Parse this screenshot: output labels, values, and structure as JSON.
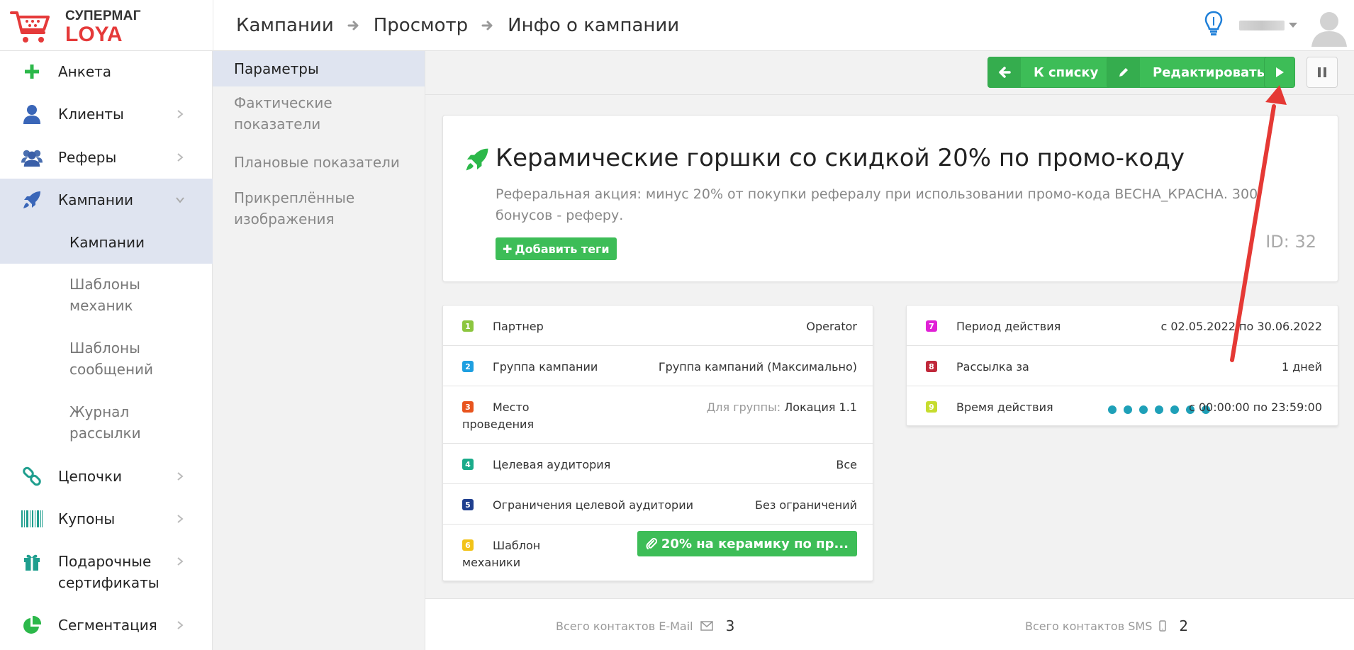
{
  "app": {
    "logo_top": "СУПЕРМАГ",
    "logo_bottom": "LOYA"
  },
  "breadcrumb": [
    "Кампании",
    "Просмотр",
    "Инфо о кампании"
  ],
  "sidebar": {
    "items": [
      {
        "label": "Анкета",
        "icon": "plus-icon"
      },
      {
        "label": "Клиенты",
        "icon": "user-icon"
      },
      {
        "label": "Реферы",
        "icon": "users-icon"
      },
      {
        "label": "Кампании",
        "icon": "rocket-icon"
      },
      {
        "label": "Цепочки",
        "icon": "chain-icon"
      },
      {
        "label": "Купоны",
        "icon": "barcode-icon"
      },
      {
        "label": "Подарочные сертификаты",
        "icon": "gift-icon"
      },
      {
        "label": "Сегментация",
        "icon": "pie-chart-icon"
      }
    ],
    "sub_items": [
      "Кампании",
      "Шаблоны механик",
      "Шаблоны сообщений",
      "Журнал рассылки"
    ]
  },
  "subnav": [
    "Параметры",
    "Фактические показатели",
    "Плановые показатели",
    "Прикреплённые изображения"
  ],
  "toolbar": {
    "back_label": "К списку",
    "edit_label": "Редактировать"
  },
  "campaign": {
    "title": "Керамические горшки со скидкой 20% по промо-коду",
    "description": "Реферальная акция: минус 20% от покупки рефералу при использовании промо-кода ВЕСНА_КРАСНА. 300 бонусов - реферу.",
    "add_tags_label": "Добавить теги",
    "id_label": "ID: 32"
  },
  "left_params": [
    {
      "num": "1",
      "color": "#8cc63f",
      "label": "Партнер",
      "value": "Operator"
    },
    {
      "num": "2",
      "color": "#1e9fe0",
      "label": "Группа кампании",
      "value": "Группа кампаний (Максимально)"
    },
    {
      "num": "3",
      "color": "#e8541e",
      "label": "Место проведения",
      "value_prefix": "Для группы:",
      "value": "Локация 1.1"
    },
    {
      "num": "4",
      "color": "#1aab8a",
      "label": "Целевая аудитория",
      "value": "Все"
    },
    {
      "num": "5",
      "color": "#1f3f8f",
      "label": "Ограничения целевой аудитории",
      "value": "Без ограничений"
    },
    {
      "num": "6",
      "color": "#f2c318",
      "label": "Шаблон механики",
      "value": "20% на керамику по пр..."
    }
  ],
  "right_params": [
    {
      "num": "7",
      "color": "#e020d6",
      "label": "Период действия",
      "value": "с 02.05.2022 по 30.06.2022"
    },
    {
      "num": "8",
      "color": "#c0283a",
      "label": "Рассылка за",
      "value": "1 дней"
    },
    {
      "num": "9",
      "color": "#c6dc2e",
      "label": "Время действия",
      "value": "с 00:00:00 по 23:59:00",
      "weekdays_active": 7
    }
  ],
  "footer": {
    "email_label": "Всего контактов E-Mail",
    "email_count": "3",
    "sms_label": "Всего контактов SMS",
    "sms_count": "2"
  },
  "colors": {
    "green": "#3dbd57",
    "active_bg": "#dfe4f0",
    "logo_red": "#e53a3a",
    "annotation_red": "#e53935"
  }
}
